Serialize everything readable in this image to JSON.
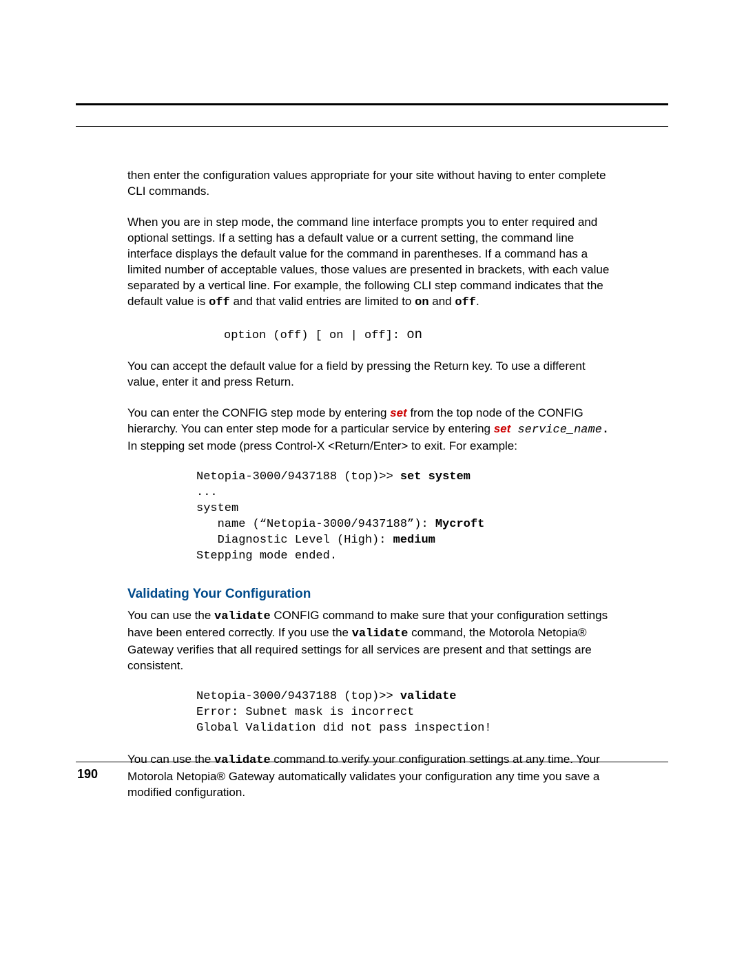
{
  "para1": "then enter the configuration values appropriate for your site without having to enter complete CLI commands.",
  "para2_a": "When you are in step mode, the command line interface prompts you to enter required and optional settings. If a setting has a default value or a current setting, the command line interface displays the default value for the command in parentheses. If a command has a limited number of acceptable values, those values are presented in brackets, with each value separated by a vertical line. For example, the following CLI step command indicates that the default value is ",
  "para2_off": "off",
  "para2_b": " and that valid entries are limited to ",
  "para2_on": "on",
  "para2_c": " and ",
  "para2_off2": "off",
  "para2_d": ".",
  "code1_a": "option (off) [ on | off]: ",
  "code1_b": "on",
  "para3": "You can accept the default value for a field by pressing the Return key. To use a different value, enter it and press Return.",
  "para4_a": "You can enter the CONFIG step mode by entering ",
  "para4_set1": "set",
  "para4_b": " from the top node of the CONFIG hierarchy. You can enter step mode for a particular service by entering ",
  "para4_set2": "set",
  "para4_svc": " service_name",
  "para4_dot": ".",
  "para4_c": " In stepping set mode (press Control-X <Return/Enter> to exit. For example:",
  "code2_l1a": "Netopia-3000/9437188 (top)>> ",
  "code2_l1b": "set system",
  "code2_l2": "...",
  "code2_l3": "system",
  "code2_l4a": "   name (“Netopia-3000/9437188”): ",
  "code2_l4b": "Mycroft",
  "code2_l5a": "   Diagnostic Level (High): ",
  "code2_l5b": "medium",
  "code2_l6": "Stepping mode ended.",
  "heading": "Validating Your Configuration",
  "para5_a": "You can use the ",
  "para5_validate": "validate",
  "para5_b": " CONFIG command to make sure that your configuration settings have been entered correctly. If you use the ",
  "para5_validate2": "validate",
  "para5_c": " command, the Motorola Netopia® Gateway verifies that all required settings for all services are present and that settings are consistent.",
  "code3_l1a": "Netopia-3000/9437188 (top)>> ",
  "code3_l1b": "validate",
  "code3_l2": "Error: Subnet mask is incorrect",
  "code3_l3": "Global Validation did not pass inspection!",
  "para6_a": "You can use the ",
  "para6_validate": "validate",
  "para6_b": " command to verify your configuration settings at any time. Your Motorola Netopia® Gateway automatically validates your configuration any time you save a modified configuration.",
  "page_number": "190"
}
